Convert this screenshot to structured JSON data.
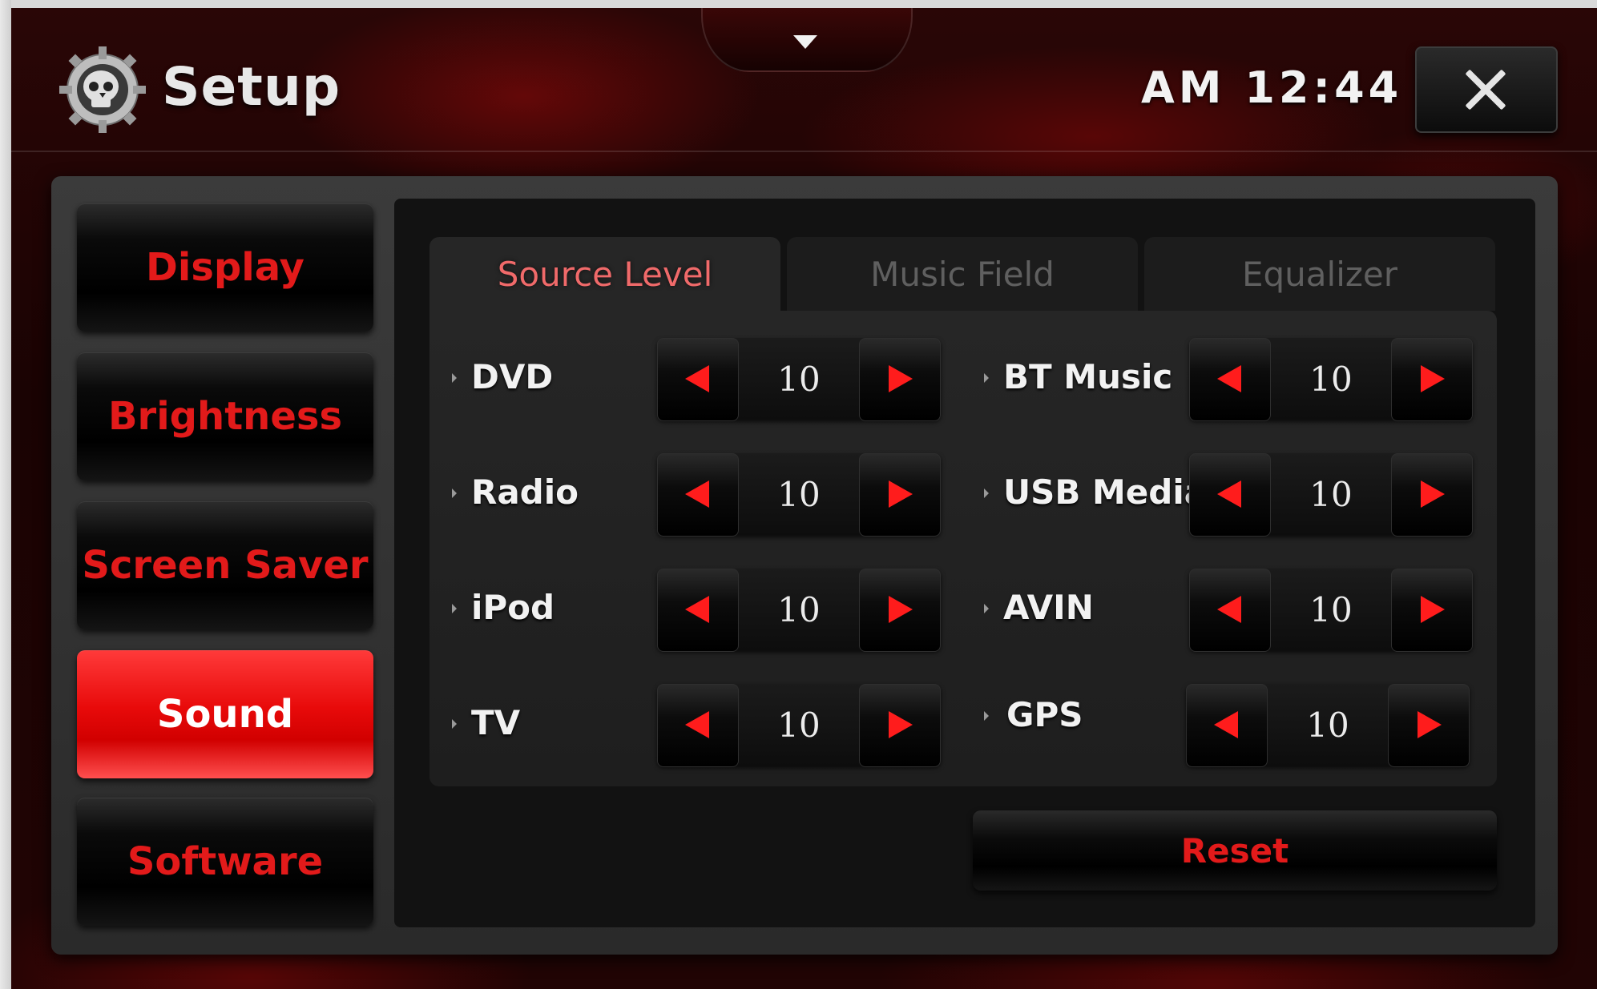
{
  "header": {
    "title": "Setup",
    "clock": "AM 12:44"
  },
  "sidebar": {
    "items": [
      {
        "label": "Display"
      },
      {
        "label": "Brightness"
      },
      {
        "label": "Screen Saver"
      },
      {
        "label": "Sound",
        "active": true
      },
      {
        "label": "Software"
      }
    ]
  },
  "tabs": [
    {
      "label": "Source Level",
      "active": true
    },
    {
      "label": "Music Field"
    },
    {
      "label": "Equalizer"
    }
  ],
  "levels": {
    "left": [
      {
        "label": "DVD",
        "value": "10"
      },
      {
        "label": "Radio",
        "value": "10"
      },
      {
        "label": "iPod",
        "value": "10"
      },
      {
        "label": "TV",
        "value": "10"
      }
    ],
    "right": [
      {
        "label": "BT Music",
        "value": "10"
      },
      {
        "label": "USB Media",
        "value": "10"
      },
      {
        "label": "AVIN",
        "value": "10"
      },
      {
        "label": "GPS",
        "value": "10"
      }
    ]
  },
  "reset_label": "Reset",
  "colors": {
    "accent": "#e21a1a",
    "active_button": "#ff2a2a",
    "background": "#1a0303"
  }
}
